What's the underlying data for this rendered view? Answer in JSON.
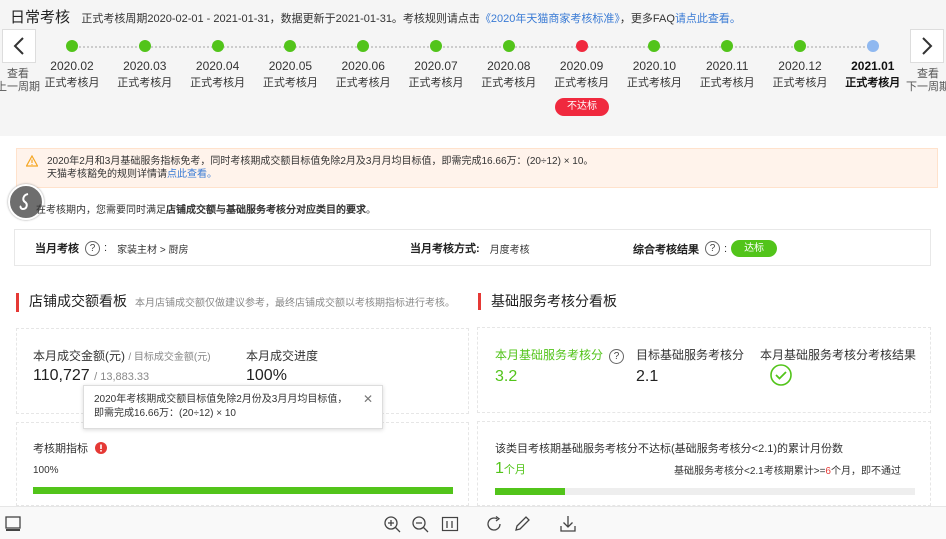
{
  "header": {
    "title": "日常考核",
    "period_text": "正式考核周期2020-02-01 - 2021-01-31，数据更新于2021-01-31。考核规则请点击",
    "rule_link": "《2020年天猫商家考核标准》",
    "faq_text": "，更多FAQ",
    "faq_link": "请点此查看。"
  },
  "nav": {
    "prev_label_1": "查看",
    "prev_label_2": "上一周期",
    "next_label_1": "查看",
    "next_label_2": "下一周期"
  },
  "months": [
    {
      "date": "2020.02",
      "type": "正式考核月",
      "status": "pass"
    },
    {
      "date": "2020.03",
      "type": "正式考核月",
      "status": "pass"
    },
    {
      "date": "2020.04",
      "type": "正式考核月",
      "status": "pass"
    },
    {
      "date": "2020.05",
      "type": "正式考核月",
      "status": "pass"
    },
    {
      "date": "2020.06",
      "type": "正式考核月",
      "status": "pass"
    },
    {
      "date": "2020.07",
      "type": "正式考核月",
      "status": "pass"
    },
    {
      "date": "2020.08",
      "type": "正式考核月",
      "status": "pass"
    },
    {
      "date": "2020.09",
      "type": "正式考核月",
      "status": "fail"
    },
    {
      "date": "2020.10",
      "type": "正式考核月",
      "status": "pass"
    },
    {
      "date": "2020.11",
      "type": "正式考核月",
      "status": "pass"
    },
    {
      "date": "2020.12",
      "type": "正式考核月",
      "status": "pass"
    },
    {
      "date": "2021.01",
      "type": "正式考核月",
      "status": "current"
    }
  ],
  "fail_badge": "不达标",
  "colors": {
    "pass": "#52c41a",
    "fail": "#f0293e",
    "current": "#8fb8f0",
    "accent_red": "#e53935",
    "link": "#3a7bd5"
  },
  "notice": {
    "line1": "2020年2月和3月基础服务指标免考，同时考核期成交额目标值免除2月及3月月均目标值，即需完成16.66万：(20÷12) × 10。",
    "line2": "天猫考核豁免的规则详情请",
    "line2_link": "点此查看。"
  },
  "requirement": {
    "prefix": "在考核期内，您需要同时满足",
    "bold": "店铺成交额与基础服务考核分对应类目的要求",
    "suffix": "。"
  },
  "info_bar": {
    "month_label": "当月考核",
    "month_value": "家装主材 > 厨房",
    "mode_label": "当月考核方式:",
    "mode_value": "月度考核",
    "result_label": "综合考核结果",
    "result_value": "达标"
  },
  "left_section": {
    "title": "店铺成交额看板",
    "subtitle": "本月店铺成交额仅做建议参考，最终店铺成交额以考核期指标进行考核。",
    "amount_label": "本月成交金额(元)",
    "target_label": "/ 目标成交金额(元)",
    "amount_value": "110,727",
    "target_value": "13,883.33",
    "progress_label": "本月成交进度",
    "progress_value": "100%",
    "period_label": "考核期指标",
    "period_progress_text": "100%",
    "period_progress": 1.0
  },
  "tooltip": {
    "line1": "2020年考核期成交额目标值免除2月份及3月月均目标值，",
    "line2": "即需完成16.66万：(20÷12) × 10"
  },
  "right_section": {
    "title": "基础服务考核分看板",
    "score_label": "本月基础服务考核分",
    "score_value": "3.2",
    "target_label": "目标基础服务考核分",
    "target_value": "2.1",
    "result_label": "本月基础服务考核分考核结果",
    "desc": "该类目考核期基础服务考核分不达标(基础服务考核分<2.1)的累计月份数",
    "count_value": "1",
    "count_unit": "个月",
    "rule_prefix": "基础服务考核分<2.1考核期累计>=",
    "rule_num": "6",
    "rule_suffix": "个月，即不通过",
    "fail_progress": 0.167
  }
}
